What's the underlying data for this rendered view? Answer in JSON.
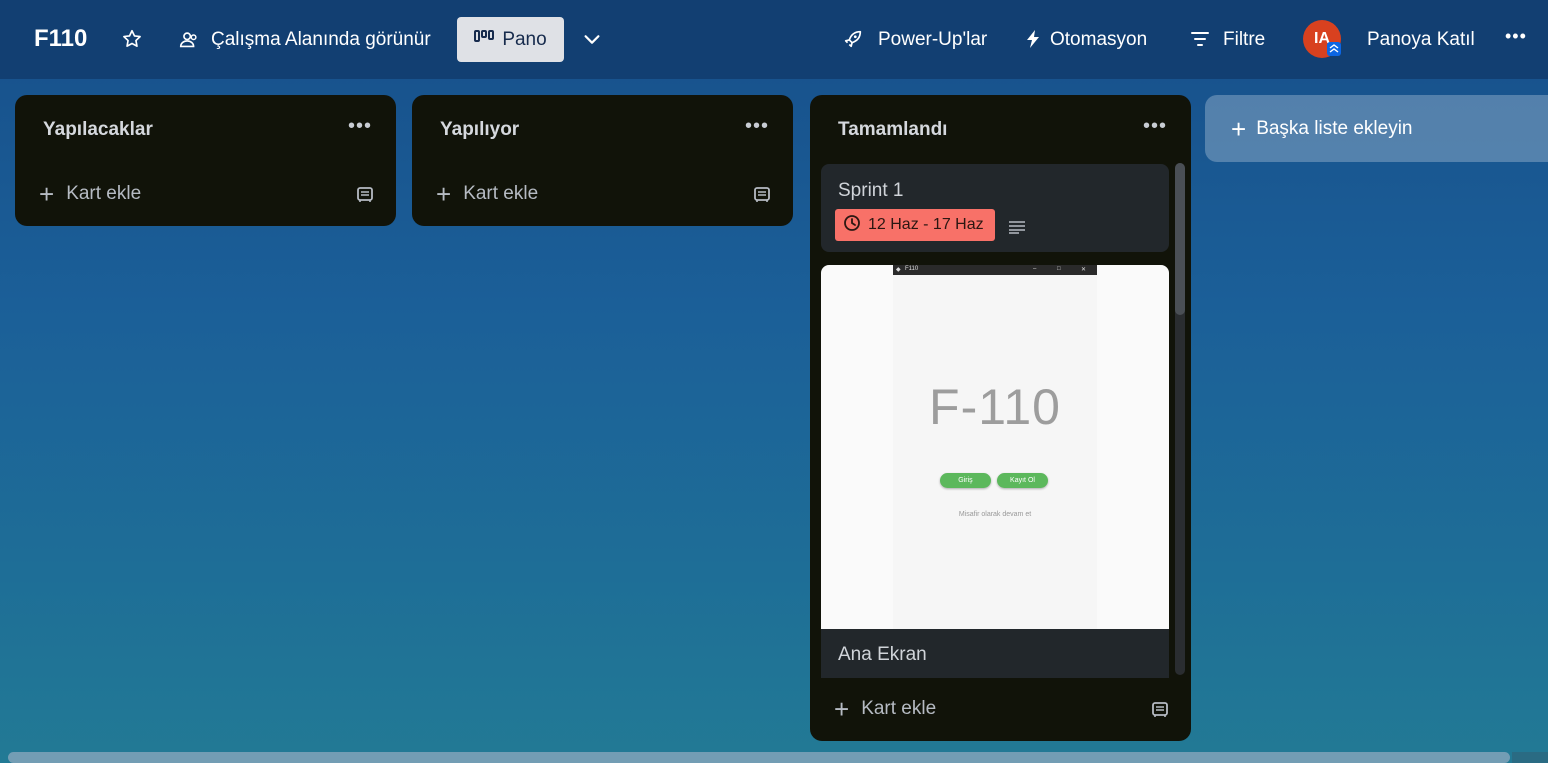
{
  "header": {
    "board_title": "F110",
    "visibility_label": "Çalışma Alanında görünür",
    "view_label": "Pano",
    "powerups_label": "Power-Up'lar",
    "automation_label": "Otomasyon",
    "filter_label": "Filtre",
    "avatar_initials": "IA",
    "join_label": "Panoya Katıl",
    "more_label": "•••"
  },
  "lists": [
    {
      "title": "Yapılacaklar",
      "menu": "•••",
      "add_card_label": "Kart ekle"
    },
    {
      "title": "Yapılıyor",
      "menu": "•••",
      "add_card_label": "Kart ekle"
    },
    {
      "title": "Tamamlandı",
      "menu": "•••",
      "add_card_label": "Kart ekle",
      "cards": [
        {
          "title": "Sprint 1",
          "date": "12 Haz - 17 Haz"
        },
        {
          "title": "Ana Ekran",
          "cover": {
            "window_title": "F110",
            "app_title": "F-110",
            "login_button": "Giriş",
            "register_button": "Kayıt Ol",
            "guest_link": "Misafir olarak devam et"
          }
        }
      ]
    }
  ],
  "add_list_label": "Başka liste ekleyin",
  "colors": {
    "header_bg": "#123f72",
    "list_bg": "#111309",
    "card_bg": "#22272b",
    "date_badge_overdue": "#f87168",
    "avatar_bg": "#d8411f",
    "mini_button_green": "#5cb85c"
  },
  "icons": {
    "star": "star-icon",
    "visibility": "workspace-visible-icon",
    "board_view": "board-view-icon",
    "chevron": "chevron-down-icon",
    "powerups": "rocket-icon",
    "automation": "lightning-icon",
    "filter": "filter-icon",
    "template": "card-template-icon",
    "clock": "clock-icon",
    "description": "description-icon"
  }
}
